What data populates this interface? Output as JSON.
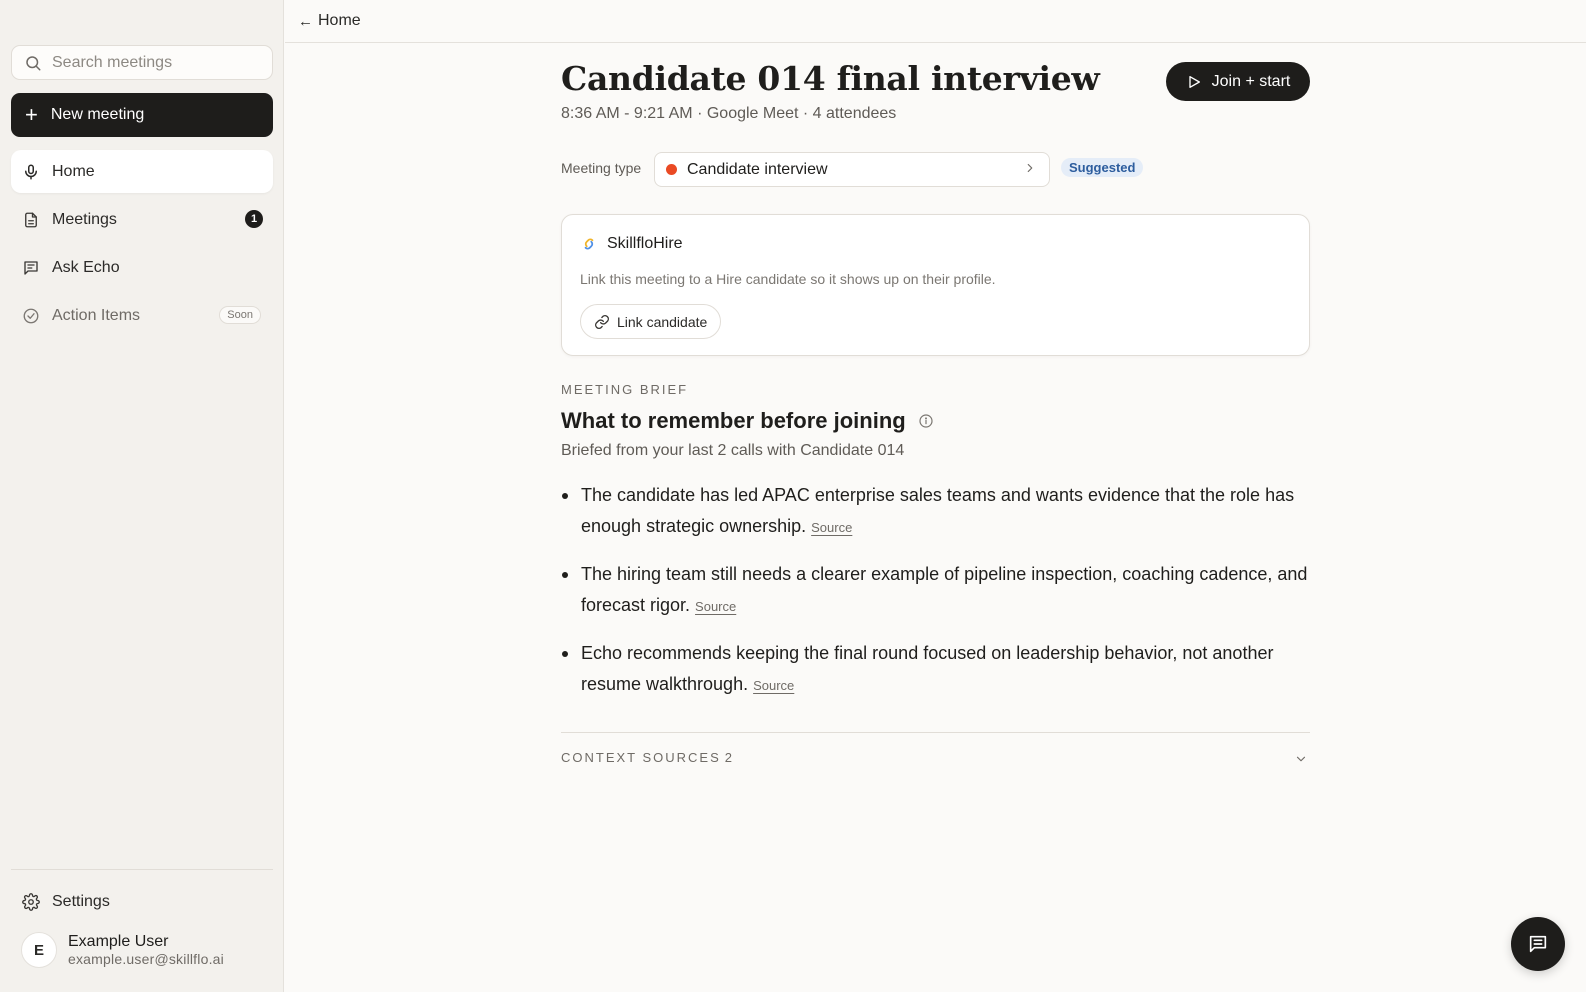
{
  "sidebar": {
    "search_placeholder": "Search meetings",
    "new_meeting_label": "New meeting",
    "nav": {
      "home": "Home",
      "meetings": "Meetings",
      "meetings_count": "1",
      "ask_echo": "Ask Echo",
      "action_items": "Action Items",
      "action_items_badge": "Soon"
    },
    "settings_label": "Settings",
    "user": {
      "initial": "E",
      "name": "Example User",
      "email": "example.user@skillflo.ai"
    }
  },
  "topbar": {
    "back_label": "Home"
  },
  "meeting": {
    "title": "Candidate 014 final interview",
    "subtitle": "8:36 AM - 9:21 AM · Google Meet · 4 attendees",
    "join_label": "Join + start",
    "type_label": "Meeting type",
    "type_value": "Candidate interview",
    "type_color": "#ea4a24",
    "suggested_label": "Suggested"
  },
  "hire_card": {
    "title": "SkillfloHire",
    "description": "Link this meeting to a Hire candidate so it shows up on their profile.",
    "link_label": "Link candidate"
  },
  "brief": {
    "section_label": "MEETING BRIEF",
    "title": "What to remember before joining",
    "subtitle": "Briefed from your last 2 calls with Candidate 014",
    "bullets": [
      {
        "text": "The candidate has led APAC enterprise sales teams and wants evidence that the role has enough strategic ownership.",
        "source": "Source"
      },
      {
        "text": "The hiring team still needs a clearer example of pipeline inspection, coaching cadence, and forecast rigor.",
        "source": "Source"
      },
      {
        "text": "Echo recommends keeping the final round focused on leadership behavior, not another resume walkthrough.",
        "source": "Source"
      }
    ]
  },
  "context_sources": {
    "label": "CONTEXT SOURCES",
    "count": "2"
  }
}
